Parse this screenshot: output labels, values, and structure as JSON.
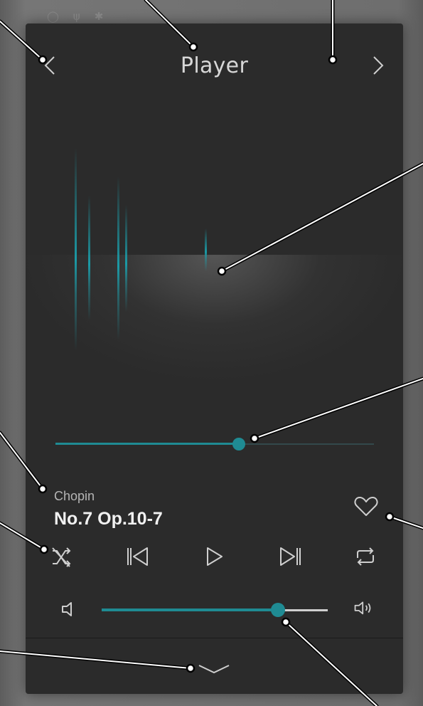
{
  "header": {
    "title": "Player"
  },
  "track": {
    "artist": "Chopin",
    "title": "No.7 Op.10-7"
  },
  "playback": {
    "progress": 0.576,
    "volume": 0.78
  },
  "colors": {
    "accent": "#1f8b93",
    "panel": "#2b2b2b",
    "text": "#f1f1f1"
  },
  "icons": {
    "prev_page": "chevron-left-icon",
    "next_page": "chevron-right-icon",
    "favorite": "heart-icon",
    "shuffle": "shuffle-icon",
    "previous": "skip-previous-icon",
    "play": "play-icon",
    "next": "skip-next-icon",
    "repeat": "repeat-icon",
    "volume_low": "volume-low-icon",
    "volume_high": "volume-high-icon",
    "collapse": "chevron-down-icon"
  }
}
